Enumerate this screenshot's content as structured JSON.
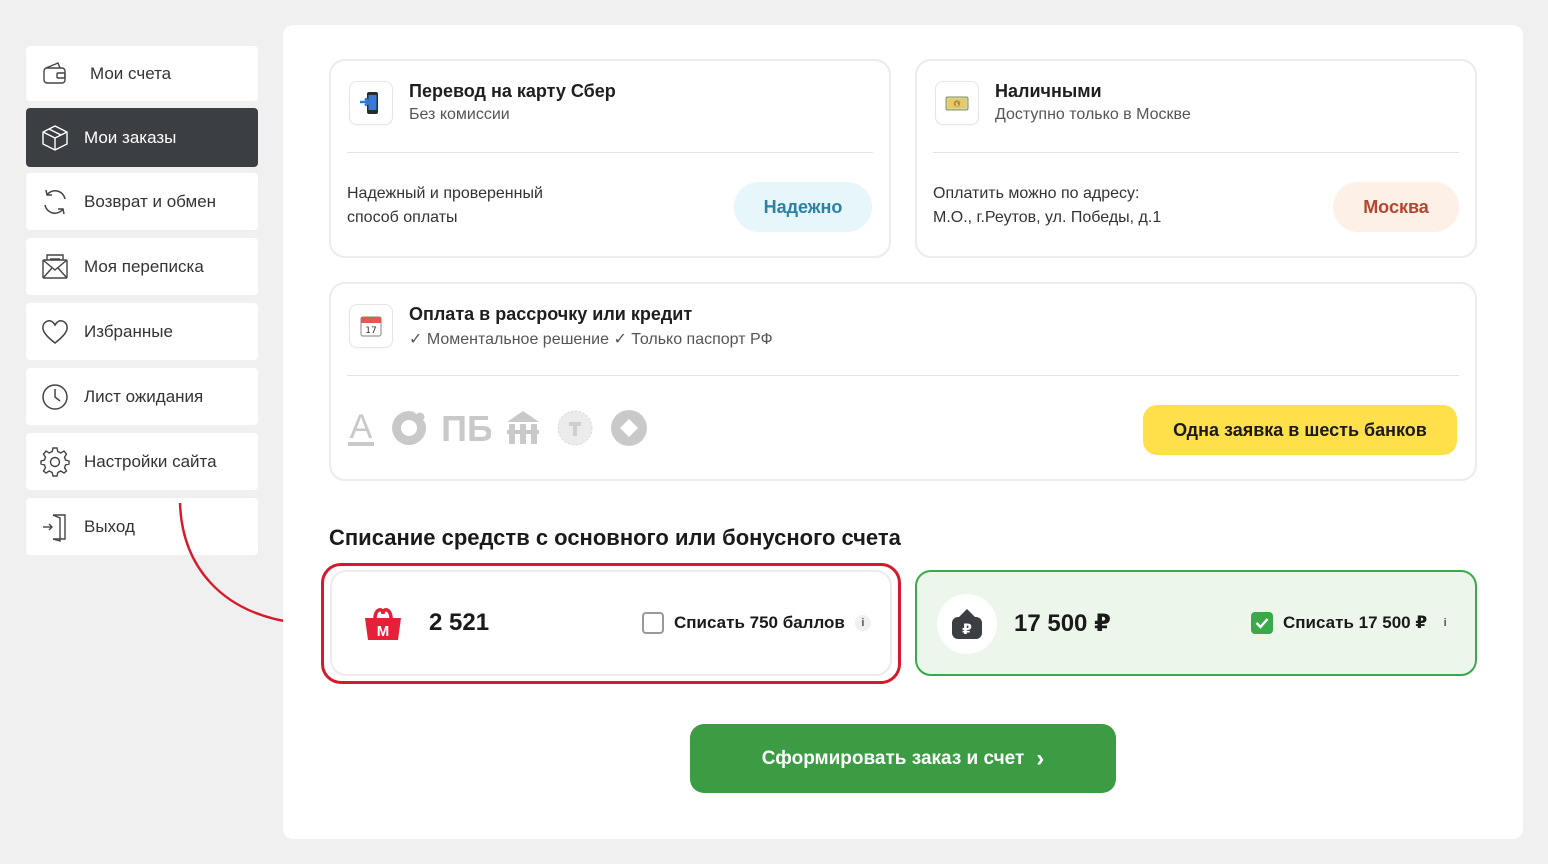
{
  "sidebar": {
    "items": [
      {
        "label": "Мои счета",
        "icon": "wallet-icon"
      },
      {
        "label": "Мои заказы",
        "icon": "box-icon",
        "active": true
      },
      {
        "label": "Возврат и обмен",
        "icon": "refresh-icon"
      },
      {
        "label": "Моя переписка",
        "icon": "mail-icon"
      },
      {
        "label": "Избранные",
        "icon": "heart-icon"
      },
      {
        "label": "Лист ожидания",
        "icon": "clock-icon"
      },
      {
        "label": "Настройки сайта",
        "icon": "gear-icon"
      },
      {
        "label": "Выход",
        "icon": "logout-icon"
      }
    ]
  },
  "payment": {
    "sber": {
      "title": "Перевод на карту Сбер",
      "subtitle": "Без комиссии",
      "desc_line1": "Надежный и проверенный",
      "desc_line2": "способ оплаты",
      "badge": "Надежно",
      "icon": "phone-transfer-icon"
    },
    "cash": {
      "title": "Наличными",
      "subtitle": "Доступно только в Москве",
      "desc_line1": "Оплатить можно по адресу:",
      "desc_line2": "М.О., г.Реутов, ул. Победы, д.1",
      "badge": "Москва",
      "icon": "cash-icon"
    },
    "credit": {
      "title": "Оплата в рассрочку или кредит",
      "subtitle": "✓ Моментальное решение ✓ Только паспорт РФ",
      "button": "Одна заявка в шесть банков",
      "calendar_day": "17",
      "icon": "calendar-icon",
      "banks": [
        "alfa-bank-icon",
        "sovcombank-icon",
        "pochtabank-icon",
        "bank-building-icon",
        "tinkoff-icon",
        "raiffeisen-icon"
      ],
      "bank_letters": {
        "alfa": "А",
        "pb": "ПБ"
      }
    }
  },
  "bonus_section": {
    "title": "Списание средств с основного или бонусного счета",
    "points": {
      "amount": "2 521",
      "label": "Списать 750 баллов",
      "checked": false,
      "icon": "megamarket-logo-icon",
      "logo_letter": "М"
    },
    "account": {
      "amount": "17 500 ₽",
      "label": "Списать 17 500 ₽",
      "checked": true,
      "icon": "wallet-ruble-icon",
      "currency_symbol": "₽"
    },
    "info_glyph": "i"
  },
  "cta": {
    "label": "Сформировать заказ и счет",
    "arrow": "›"
  },
  "colors": {
    "active_nav": "#3b3e43",
    "green": "#3b9c43",
    "highlight_red": "#d7192a",
    "yellow_button": "#ffe04b",
    "badge_blue_bg": "#e6f6fb",
    "badge_orange_bg": "#fdf0e6"
  }
}
